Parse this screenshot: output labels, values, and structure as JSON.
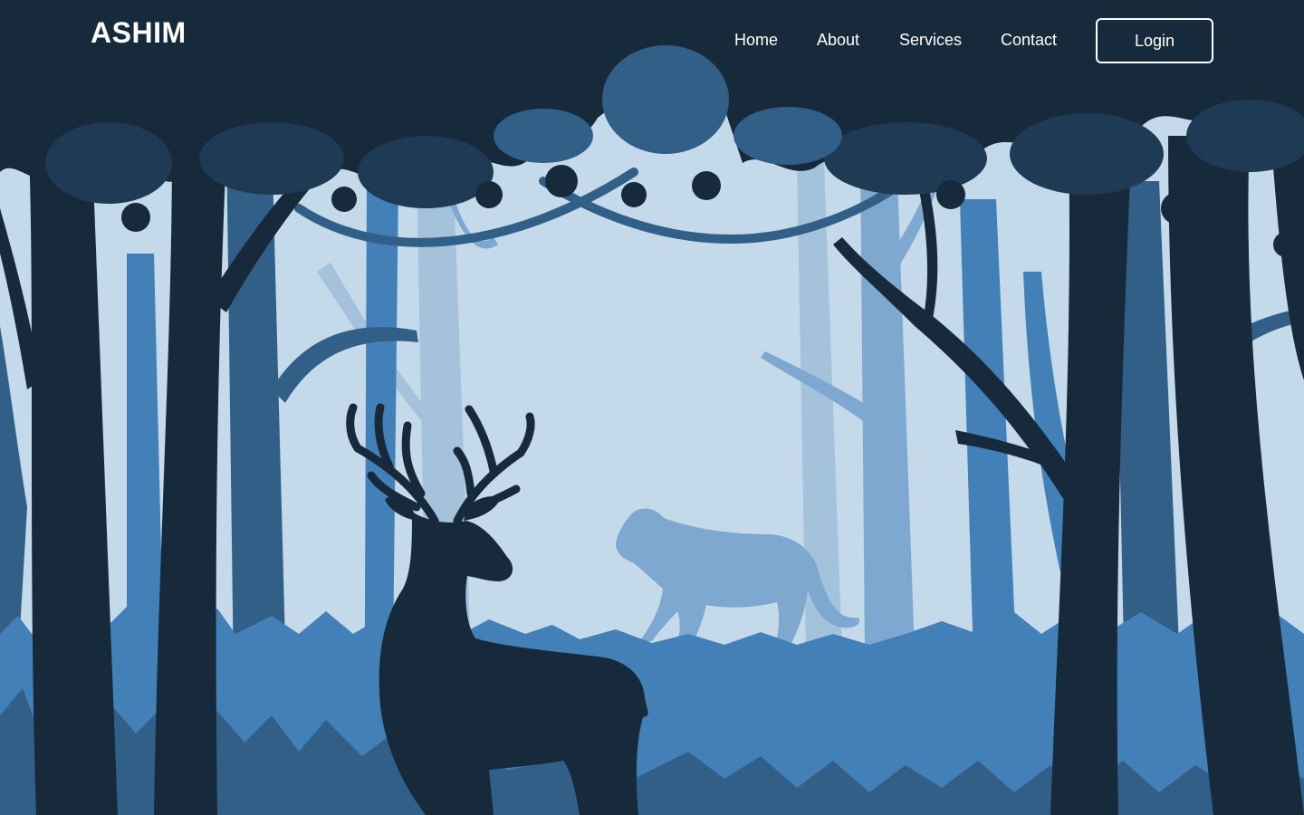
{
  "brand": {
    "name": "ASHIM"
  },
  "nav": {
    "items": [
      {
        "label": "Home"
      },
      {
        "label": "About"
      },
      {
        "label": "Services"
      },
      {
        "label": "Contact"
      }
    ],
    "login_label": "Login"
  },
  "hero": {
    "illustration": "forest-night-illustration",
    "colors": {
      "sky": "#c4d9ea",
      "canopy_dark": "#172a3b",
      "tree_mid": "#325f87",
      "tree_light": "#4380b8",
      "mist_tree": "#7ea8cf",
      "text": "#ffffff"
    }
  }
}
